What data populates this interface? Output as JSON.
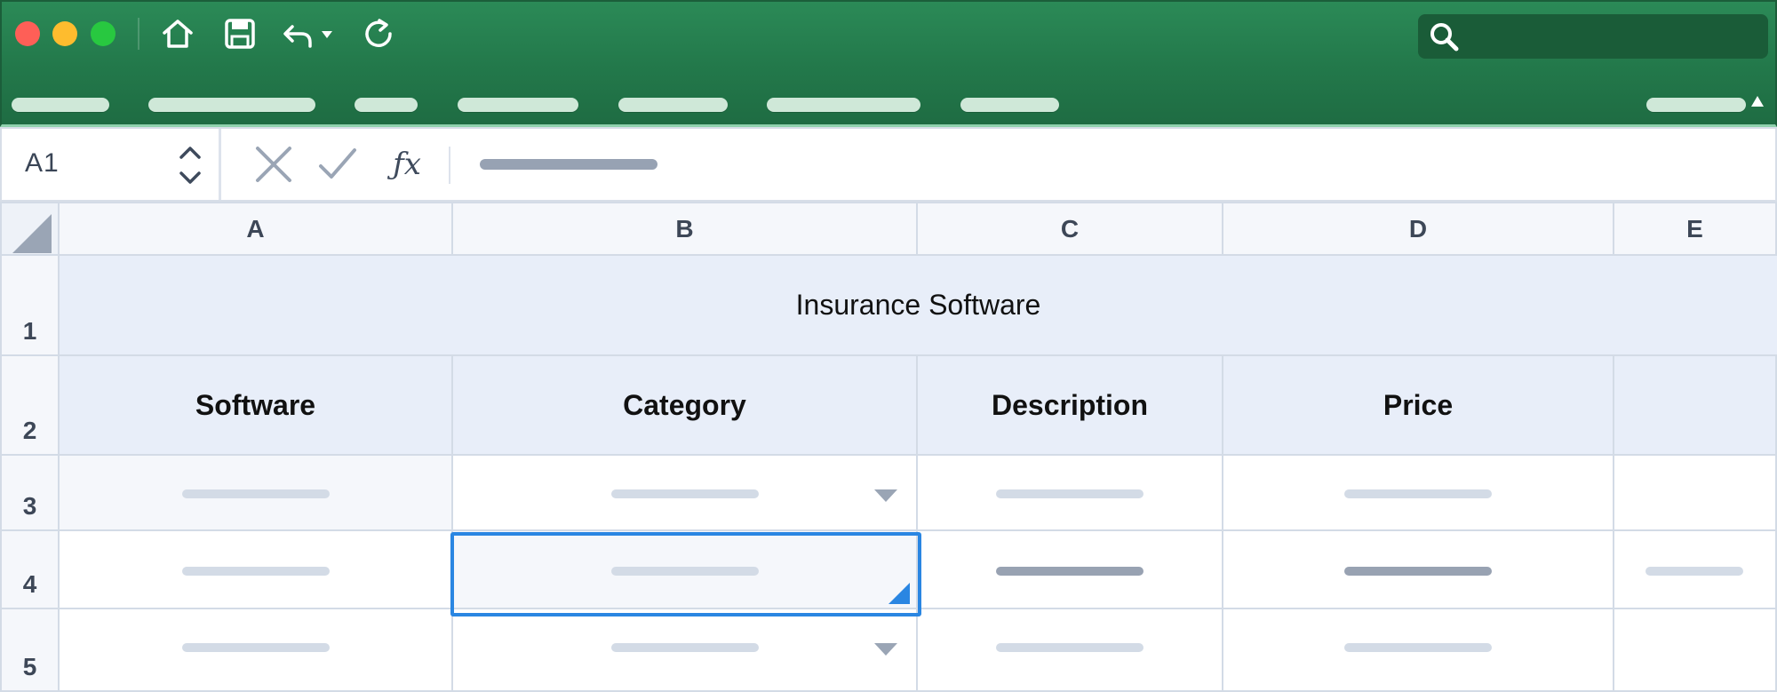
{
  "window": {
    "accent_color": "#23794b",
    "selection_color": "#2a86e2"
  },
  "toolbar": {
    "icons": [
      "home-icon",
      "save-icon",
      "undo-icon",
      "redo-icon"
    ],
    "search_placeholder": ""
  },
  "ribbon": {
    "tabs": [
      "",
      "",
      "",
      "",
      "",
      "",
      ""
    ]
  },
  "formula_bar": {
    "name_box": "A1",
    "fx_label": "ƒx"
  },
  "sheet": {
    "columns": [
      "A",
      "B",
      "C",
      "D",
      "E"
    ],
    "rows": [
      "1",
      "2",
      "3",
      "4",
      "5"
    ],
    "title": "Insurance Software",
    "headers": {
      "software": "Software",
      "category": "Category",
      "description": "Description",
      "price": "Price"
    },
    "selected_cell": "B4"
  }
}
